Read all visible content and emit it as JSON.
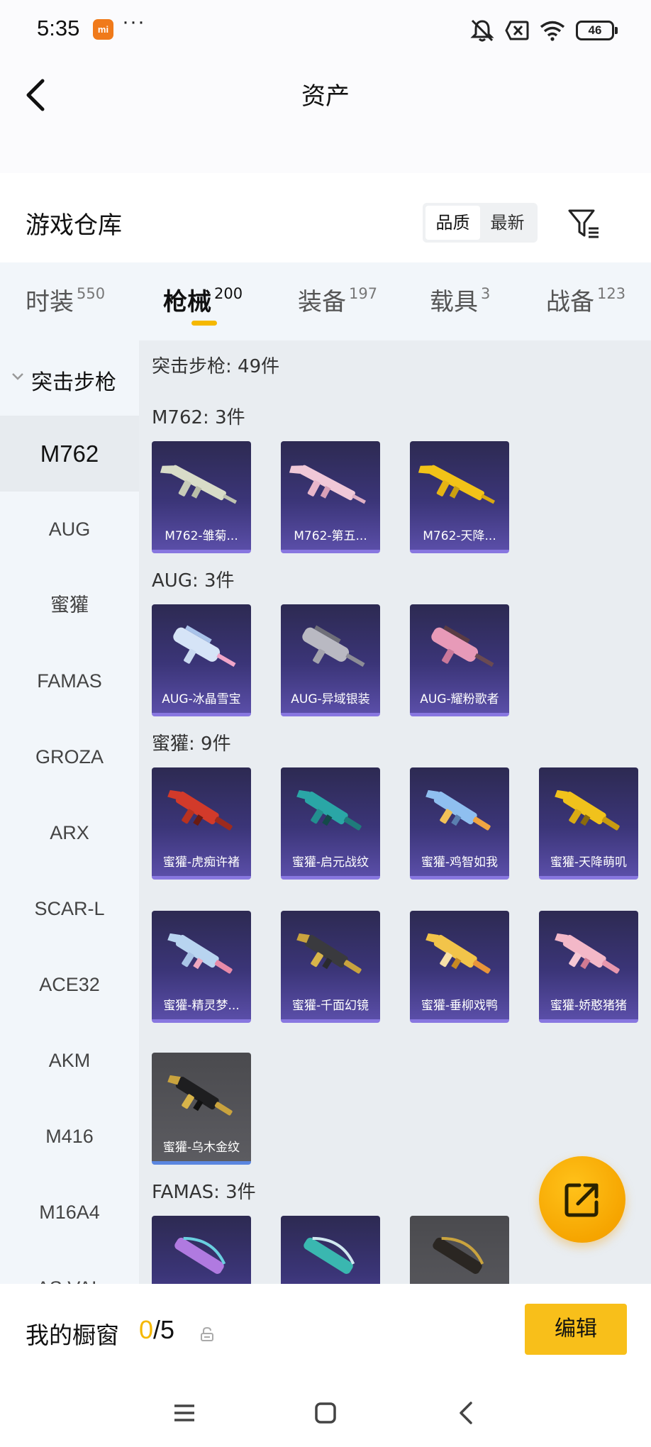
{
  "status_bar": {
    "time": "5:35",
    "mi_badge": "mi",
    "more": "···",
    "battery": "46",
    "icons": [
      "mute-icon",
      "no-sim-icon",
      "wifi-icon",
      "battery-icon"
    ]
  },
  "header": {
    "title": "资产",
    "back_icon": "back-chevron-icon"
  },
  "warehouse": {
    "title": "游戏仓库",
    "sort_options": [
      "品质",
      "最新"
    ],
    "sort_selected": "品质",
    "filter_icon": "filter-icon"
  },
  "tabs": [
    {
      "label": "时装",
      "count": "550"
    },
    {
      "label": "枪械",
      "count": "200",
      "active": true
    },
    {
      "label": "装备",
      "count": "197"
    },
    {
      "label": "载具",
      "count": "3"
    },
    {
      "label": "战备",
      "count": "123"
    }
  ],
  "sidebar": {
    "category": "突击步枪",
    "items": [
      "M762",
      "AUG",
      "蜜獾",
      "FAMAS",
      "GROZA",
      "ARX",
      "SCAR-L",
      "ACE32",
      "AKM",
      "M416",
      "M16A4",
      "AS VAL"
    ],
    "selected": "M762"
  },
  "content": {
    "total": "突击步枪: 49件",
    "groups": [
      {
        "title": "M762: 3件",
        "items": [
          "M762-雏菊...",
          "M762-第五...",
          "M762-天降..."
        ]
      },
      {
        "title": "AUG: 3件",
        "items": [
          "AUG-冰晶雪宝",
          "AUG-异域银装",
          "AUG-耀粉歌者"
        ]
      },
      {
        "title": "蜜獾: 9件",
        "items": [
          "蜜獾-虎痴许褚",
          "蜜獾-启元战纹",
          "蜜獾-鸡智如我",
          "蜜獾-天降萌叽",
          "蜜獾-精灵梦...",
          "蜜獾-千面幻镜",
          "蜜獾-垂柳戏鸭",
          "蜜獾-娇憨猪猪",
          "蜜獾-乌木金纹"
        ]
      },
      {
        "title": "FAMAS: 3件",
        "items": []
      }
    ]
  },
  "showcase": {
    "label": "我的橱窗",
    "current": "0",
    "separator": "/",
    "total": "5",
    "edit_label": "编辑",
    "lock_icon": "lock-icon"
  },
  "fab": {
    "icon": "share-external-icon"
  },
  "navbar": {
    "icons": [
      "menu-icon",
      "home-square-icon",
      "back-icon"
    ]
  },
  "colors": {
    "accent": "#f5b800",
    "card_purple": "#3b3578",
    "sidebar_bg": "#f2f6fa",
    "content_bg": "#e9edf1"
  }
}
